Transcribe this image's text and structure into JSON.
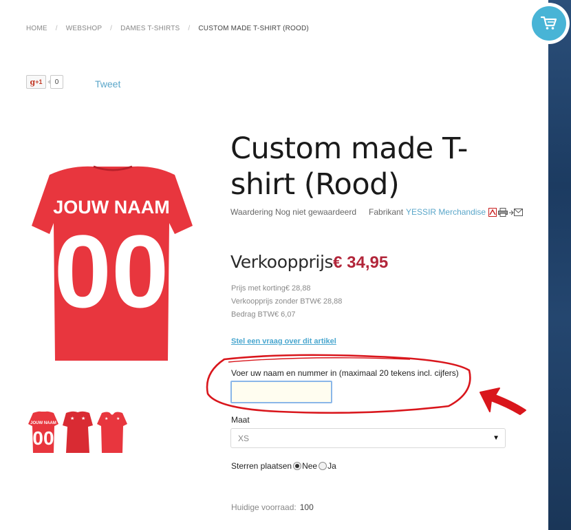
{
  "breadcrumb": {
    "items": [
      "HOME",
      "WEBSHOP",
      "DAMES T-SHIRTS"
    ],
    "current": "CUSTOM MADE T-SHIRT (ROOD)",
    "separator": "/"
  },
  "social": {
    "gplus_label": "+1",
    "gplus_glyph": "g",
    "gplus_count": "0",
    "tweet_label": "Tweet"
  },
  "product": {
    "title": "Custom made T-shirt (Rood)",
    "shirt_print_name": "JOUW NAAM",
    "shirt_print_number": "00",
    "shirt_color": "#e8363e",
    "rating_label": "Waardering",
    "rating_value": "Nog niet gewaardeerd",
    "maker_label": "Fabrikant",
    "maker_name": "YESSIR Merchandise",
    "icons": [
      "pdf-icon",
      "print-icon",
      "email-icon"
    ]
  },
  "price": {
    "label": "Verkoopprijs",
    "value": "€ 34,95",
    "details": [
      "Prijs met korting€ 28,88",
      "Verkoopprijs zonder BTW€ 28,88",
      "Bedrag BTW€ 6,07"
    ]
  },
  "ask_link": "Stel een vraag over dit artikel",
  "customization": {
    "label": "Voer uw naam en nummer in (maximaal 20 tekens incl. cijfers)",
    "value": ""
  },
  "size": {
    "label": "Maat",
    "selected": "XS",
    "caret": "▼"
  },
  "stars": {
    "label": "Sterren plaatsen",
    "options": [
      "Nee",
      "Ja"
    ],
    "selected": "Nee"
  },
  "stock": {
    "label": "Huidige voorraad:",
    "value": "100"
  },
  "colors": {
    "accent": "#48b4d6",
    "price": "#b2263a",
    "link": "#5aa6c9",
    "annotation": "#d9161c"
  }
}
